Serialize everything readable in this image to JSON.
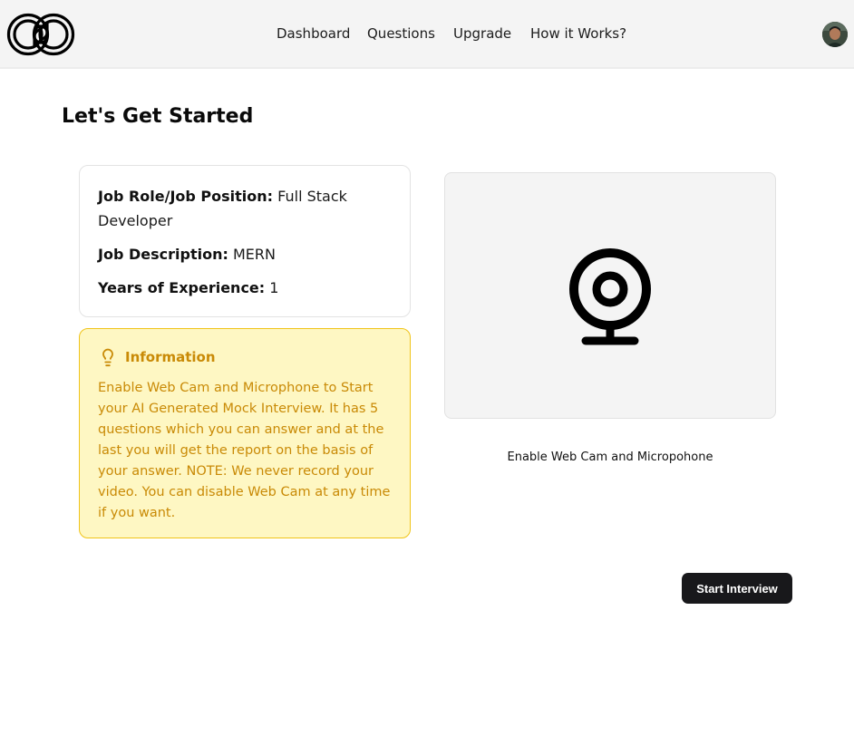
{
  "header": {
    "nav": [
      "Dashboard",
      "Questions",
      "Upgrade",
      "How it Works?"
    ]
  },
  "page": {
    "title": "Let's Get Started"
  },
  "job": {
    "role_label": "Job Role/Job Position:",
    "role_value": "Full Stack Developer",
    "description_label": "Job Description:",
    "description_value": "MERN",
    "experience_label": "Years of Experience:",
    "experience_value": "1"
  },
  "info": {
    "title": "Information",
    "text": "Enable Web Cam and Microphone to Start your AI Generated Mock Interview. It has 5 questions which you can answer and at the last you will get the report on the basis of your answer. NOTE: We never record your video. You can disable Web Cam at any time if you want.",
    "icon": "lightbulb-icon",
    "color": "#c98a06",
    "background": "#fef7c3"
  },
  "webcam": {
    "icon": "webcam-icon",
    "caption": "Enable Web Cam and Micropohone"
  },
  "actions": {
    "start_label": "Start Interview"
  }
}
